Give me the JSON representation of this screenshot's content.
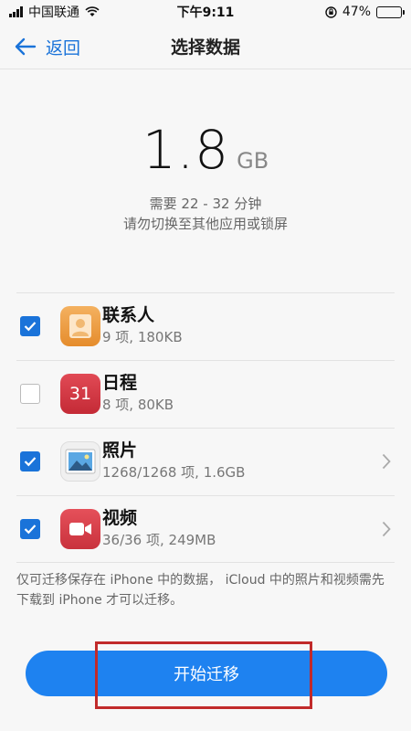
{
  "status": {
    "carrier": "中国联通",
    "time": "下午9:11",
    "battery": "47%",
    "battery_level": 0.47
  },
  "nav": {
    "back_label": "返回",
    "title": "选择数据"
  },
  "summary": {
    "size_value": "1.8",
    "size_unit": "GB",
    "duration": "需要 22 - 32 分钟",
    "warning": "请勿切换至其他应用或锁屏"
  },
  "items": [
    {
      "title": "联系人",
      "subtitle": "9 项, 180KB",
      "checked": true,
      "icon": "contacts-icon"
    },
    {
      "title": "日程",
      "subtitle": "8 项, 80KB",
      "checked": false,
      "icon": "calendar-icon",
      "icon_text": "31"
    },
    {
      "title": "照片",
      "subtitle": "1268/1268 项, 1.6GB",
      "checked": true,
      "icon": "photos-icon"
    },
    {
      "title": "视频",
      "subtitle": "36/36 项, 249MB",
      "checked": true,
      "icon": "video-icon"
    }
  ],
  "note": "仅可迁移保存在 iPhone 中的数据， iCloud 中的照片和视频需先下载到 iPhone 才可以迁移。",
  "start_button": "开始迁移",
  "colors": {
    "accent": "#1a73d9",
    "button": "#1e82f0",
    "highlight": "#c12a2a"
  }
}
